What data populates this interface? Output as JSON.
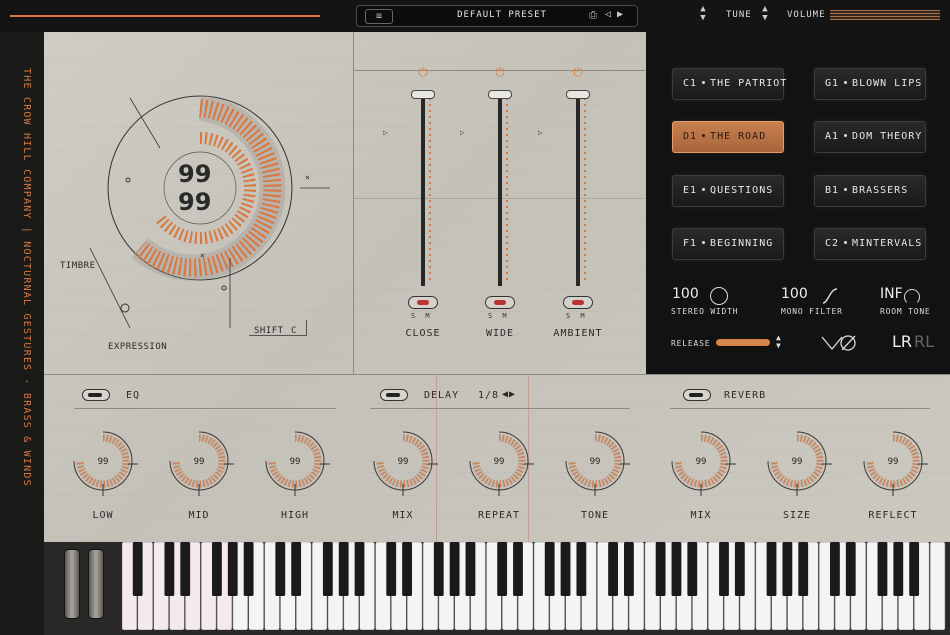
{
  "topbar": {
    "menu_icon": "hamburger-icon",
    "preset_name": "DEFAULT PRESET",
    "save_icon": "save-icon",
    "prev_icon": "◁",
    "next_icon": "▶",
    "tune_label": "TUNE",
    "volume_label": "VOLUME"
  },
  "side": {
    "title": "THE CROW HILL COMPANY | NOCTURNAL GESTURES - BRASS & WINDS"
  },
  "main": {
    "value_top": "99",
    "value_bottom": "99",
    "timbre_label": "TIMBRE",
    "expression_label": "EXPRESSION",
    "shift_label": "SHIFT",
    "shift_value": "C"
  },
  "faders": [
    {
      "name": "CLOSE",
      "sm": "S M",
      "level": 1.0
    },
    {
      "name": "WIDE",
      "sm": "S M",
      "level": 1.0
    },
    {
      "name": "AMBIENT",
      "sm": "S M",
      "level": 1.0
    }
  ],
  "articulations": [
    {
      "code": "C1",
      "name": "THE PATRIOT",
      "active": false
    },
    {
      "code": "G1",
      "name": "BLOWN LIPS",
      "active": false
    },
    {
      "code": "D1",
      "name": "THE ROAD",
      "active": true
    },
    {
      "code": "A1",
      "name": "DOM THEORY",
      "active": false
    },
    {
      "code": "E1",
      "name": "QUESTIONS",
      "active": false
    },
    {
      "code": "B1",
      "name": "BRASSERS",
      "active": false
    },
    {
      "code": "F1",
      "name": "BEGINNING",
      "active": false
    },
    {
      "code": "C2",
      "name": "MINTERVALS",
      "active": false
    }
  ],
  "controls": {
    "stereo_width_value": "100",
    "stereo_width_label": "STEREO WIDTH",
    "mono_filter_value": "100",
    "mono_filter_label": "MONO FILTER",
    "room_tone_value": "INF",
    "room_tone_label": "ROOM TONE",
    "release_label": "RELEASE",
    "lr_label": "LR",
    "rl_label": "RL"
  },
  "effects": {
    "eq": {
      "title": "EQ",
      "knobs": [
        {
          "label": "LOW",
          "value": "99"
        },
        {
          "label": "MID",
          "value": "99"
        },
        {
          "label": "HIGH",
          "value": "99"
        }
      ]
    },
    "delay": {
      "title": "DELAY",
      "division": "1/8",
      "knobs": [
        {
          "label": "MIX",
          "value": "99"
        },
        {
          "label": "REPEAT",
          "value": "99"
        },
        {
          "label": "TONE",
          "value": "99"
        }
      ]
    },
    "reverb": {
      "title": "REVERB",
      "knobs": [
        {
          "label": "MIX",
          "value": "99"
        },
        {
          "label": "SIZE",
          "value": "99"
        },
        {
          "label": "REFLECT",
          "value": "99"
        }
      ]
    }
  },
  "colors": {
    "accent": "#e07a3a",
    "paper": "#cbc8c0",
    "dark_panel": "#121212"
  }
}
